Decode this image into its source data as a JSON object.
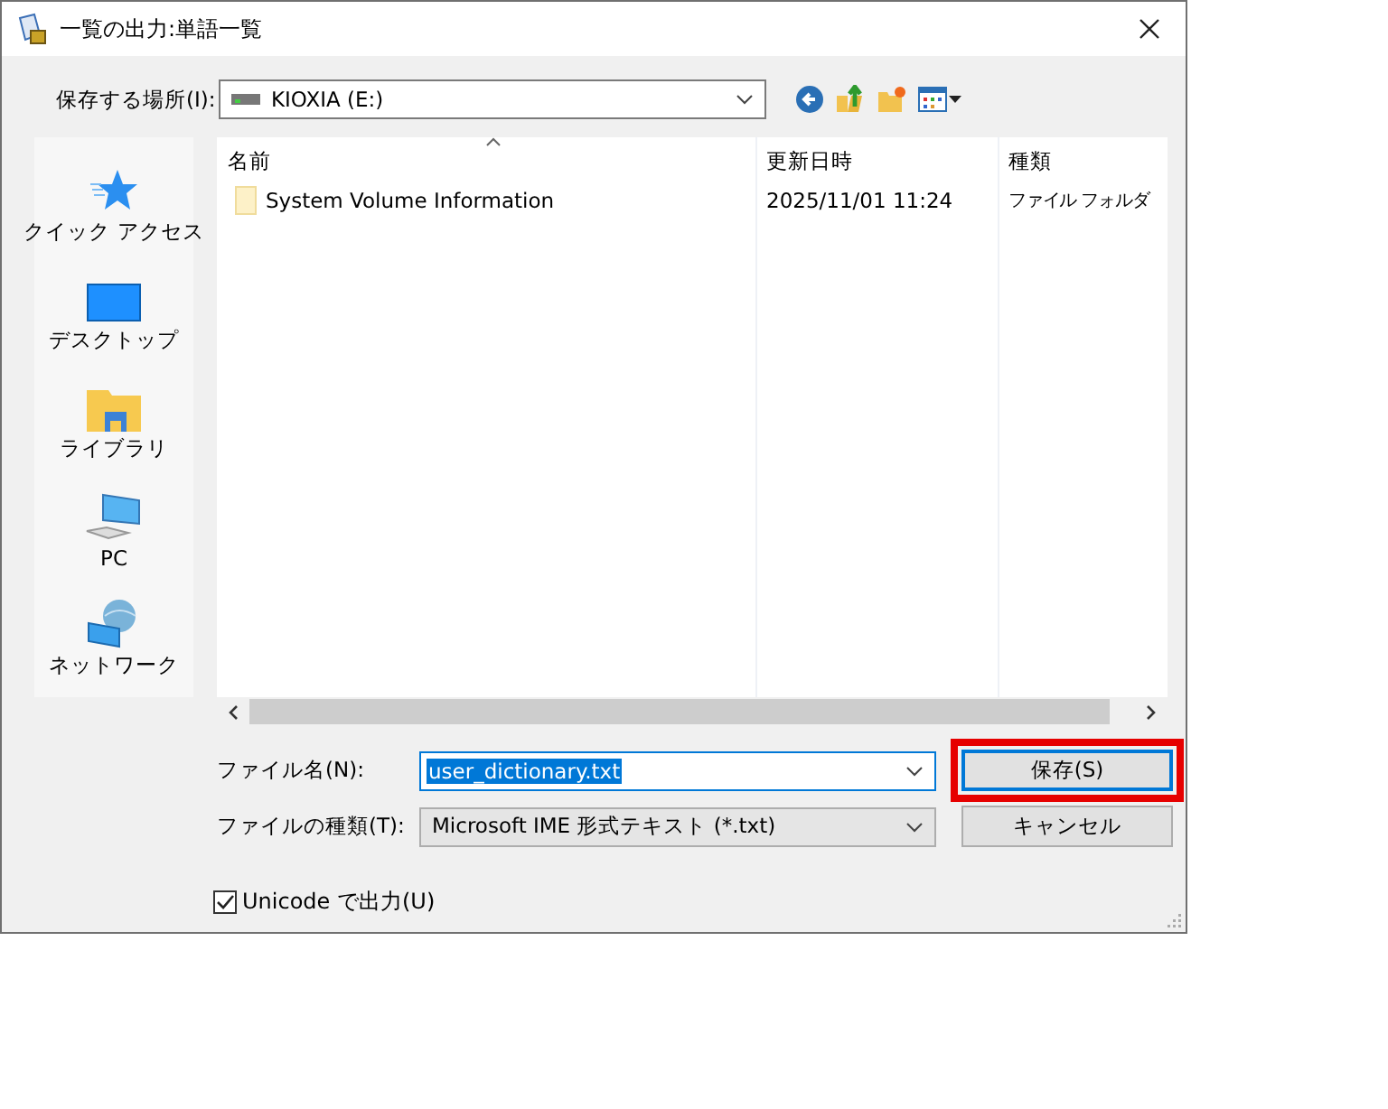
{
  "window": {
    "title": "一覧の出力:単語一覧"
  },
  "location": {
    "label": "保存する場所(I):",
    "value": "KIOXIA (E:)"
  },
  "places": [
    {
      "kind": "quick_access",
      "label": "クイック アクセス"
    },
    {
      "kind": "desktop",
      "label": "デスクトップ"
    },
    {
      "kind": "library",
      "label": "ライブラリ"
    },
    {
      "kind": "pc",
      "label": "PC"
    },
    {
      "kind": "network",
      "label": "ネットワーク"
    }
  ],
  "columns": [
    {
      "label": "名前",
      "sorted": true
    },
    {
      "label": "更新日時",
      "sorted": false
    },
    {
      "label": "種類",
      "sorted": false
    }
  ],
  "rows": [
    {
      "name": "System Volume Information",
      "modified": "2025/11/01 11:24",
      "type": "ファイル フォルダ"
    }
  ],
  "file_name": {
    "label": "ファイル名(N):",
    "value": "user_dictionary.txt",
    "selected": true
  },
  "file_type": {
    "label": "ファイルの種類(T):",
    "value": "Microsoft IME 形式テキスト (*.txt)"
  },
  "buttons": [
    {
      "label": "保存(S)",
      "default": true,
      "highlighted": true
    },
    {
      "label": "キャンセル",
      "default": false,
      "highlighted": false
    }
  ],
  "unicode": {
    "label": "Unicode で出力(U)",
    "checked": true
  }
}
